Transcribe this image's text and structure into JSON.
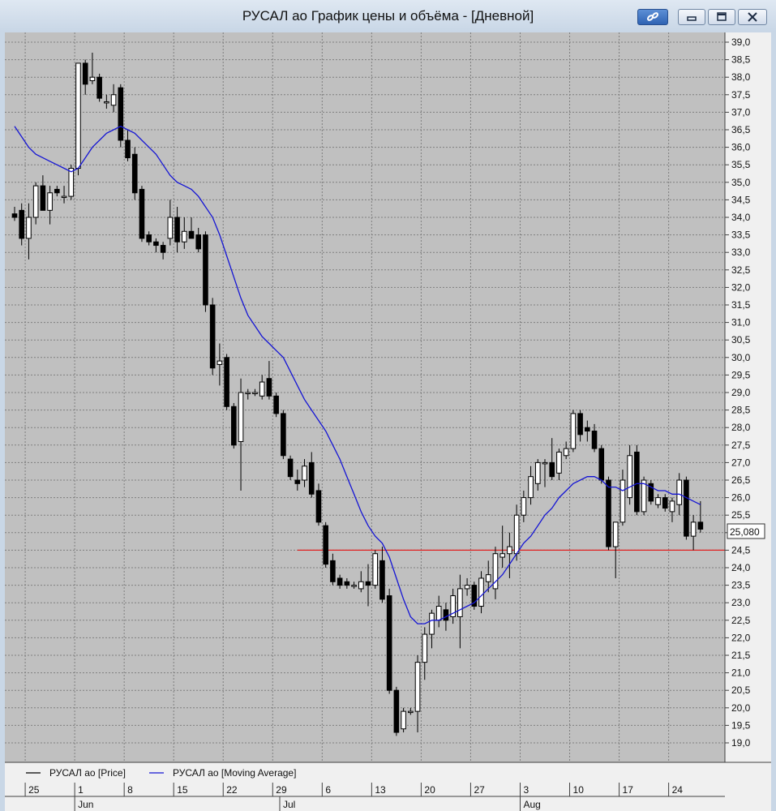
{
  "window": {
    "title": "РУСАЛ ао График цены и объёма - [Дневной]"
  },
  "colors": {
    "plot_background": "#c0c0c0",
    "grid": "#7f7f7f",
    "candle_up": "#ffffff",
    "candle_down": "#000000",
    "moving_average": "#1515d4",
    "support_line": "#e02020"
  },
  "legend": [
    {
      "label": "РУСАЛ ао [Price]",
      "color": "#000000"
    },
    {
      "label": "РУСАЛ ао [Moving Average]",
      "color": "#1515d4"
    }
  ],
  "last_price_label": "25,080",
  "chart_data": {
    "type": "candlestick",
    "ylim": [
      18.7,
      39.2
    ],
    "y_ticks": [
      "39,0",
      "38,5",
      "38,0",
      "37,5",
      "37,0",
      "36,5",
      "36,0",
      "35,5",
      "35,0",
      "34,5",
      "34,0",
      "33,5",
      "33,0",
      "32,5",
      "32,0",
      "31,5",
      "31,0",
      "30,5",
      "30,0",
      "29,5",
      "29,0",
      "28,5",
      "28,0",
      "27,5",
      "27,0",
      "26,5",
      "26,0",
      "25,5",
      "25,0",
      "24,5",
      "24,0",
      "23,5",
      "23,0",
      "22,5",
      "22,0",
      "21,5",
      "21,0",
      "20,5",
      "20,0",
      "19,5",
      "19,0"
    ],
    "x_ticks": [
      {
        "label": "25",
        "index": 2
      },
      {
        "label": "1",
        "index": 9
      },
      {
        "label": "8",
        "index": 16
      },
      {
        "label": "15",
        "index": 23
      },
      {
        "label": "22",
        "index": 30
      },
      {
        "label": "29",
        "index": 37
      },
      {
        "label": "6",
        "index": 44
      },
      {
        "label": "13",
        "index": 51
      },
      {
        "label": "20",
        "index": 58
      },
      {
        "label": "27",
        "index": 65
      },
      {
        "label": "3",
        "index": 72
      },
      {
        "label": "10",
        "index": 79
      },
      {
        "label": "17",
        "index": 86
      },
      {
        "label": "24",
        "index": 93
      }
    ],
    "months": [
      {
        "label": "Jun",
        "index": 9
      },
      {
        "label": "Jul",
        "index": 38
      },
      {
        "label": "Aug",
        "index": 72
      }
    ],
    "support_level": {
      "value": 24.5,
      "from_index": 40
    },
    "last_price": 25.08,
    "candles": [
      {
        "o": 34.1,
        "h": 34.3,
        "l": 33.9,
        "c": 34.0
      },
      {
        "o": 34.2,
        "h": 34.4,
        "l": 33.2,
        "c": 33.4
      },
      {
        "o": 33.4,
        "h": 34.4,
        "l": 32.8,
        "c": 34.0
      },
      {
        "o": 34.0,
        "h": 35.0,
        "l": 33.8,
        "c": 34.9
      },
      {
        "o": 34.9,
        "h": 35.2,
        "l": 34.2,
        "c": 34.2
      },
      {
        "o": 34.2,
        "h": 34.9,
        "l": 33.8,
        "c": 34.7
      },
      {
        "o": 34.8,
        "h": 34.9,
        "l": 34.6,
        "c": 34.7
      },
      {
        "o": 34.6,
        "h": 34.9,
        "l": 34.4,
        "c": 34.6
      },
      {
        "o": 34.6,
        "h": 35.5,
        "l": 34.5,
        "c": 35.4
      },
      {
        "o": 35.4,
        "h": 38.4,
        "l": 35.2,
        "c": 38.4
      },
      {
        "o": 38.4,
        "h": 38.5,
        "l": 37.5,
        "c": 37.8
      },
      {
        "o": 37.9,
        "h": 38.7,
        "l": 37.8,
        "c": 38.0
      },
      {
        "o": 38.0,
        "h": 38.1,
        "l": 37.3,
        "c": 37.4
      },
      {
        "o": 37.3,
        "h": 37.5,
        "l": 37.1,
        "c": 37.3
      },
      {
        "o": 37.2,
        "h": 37.8,
        "l": 37.0,
        "c": 37.5
      },
      {
        "o": 37.7,
        "h": 37.8,
        "l": 36.0,
        "c": 36.2
      },
      {
        "o": 36.2,
        "h": 36.5,
        "l": 35.6,
        "c": 35.7
      },
      {
        "o": 35.8,
        "h": 36.0,
        "l": 34.5,
        "c": 34.7
      },
      {
        "o": 34.8,
        "h": 34.9,
        "l": 33.3,
        "c": 33.4
      },
      {
        "o": 33.5,
        "h": 33.6,
        "l": 33.2,
        "c": 33.3
      },
      {
        "o": 33.3,
        "h": 33.4,
        "l": 33.0,
        "c": 33.2
      },
      {
        "o": 33.2,
        "h": 33.3,
        "l": 32.8,
        "c": 33.0
      },
      {
        "o": 33.4,
        "h": 34.5,
        "l": 33.2,
        "c": 34.0
      },
      {
        "o": 34.0,
        "h": 34.3,
        "l": 33.0,
        "c": 33.3
      },
      {
        "o": 33.3,
        "h": 34.0,
        "l": 33.1,
        "c": 33.6
      },
      {
        "o": 33.6,
        "h": 34.0,
        "l": 33.4,
        "c": 33.4
      },
      {
        "o": 33.5,
        "h": 33.7,
        "l": 33.0,
        "c": 33.1
      },
      {
        "o": 33.5,
        "h": 33.6,
        "l": 31.3,
        "c": 31.5
      },
      {
        "o": 31.5,
        "h": 31.7,
        "l": 29.5,
        "c": 29.7
      },
      {
        "o": 29.8,
        "h": 30.4,
        "l": 29.2,
        "c": 29.9
      },
      {
        "o": 30.0,
        "h": 30.1,
        "l": 28.5,
        "c": 28.6
      },
      {
        "o": 28.6,
        "h": 28.7,
        "l": 27.4,
        "c": 27.5
      },
      {
        "o": 27.6,
        "h": 29.4,
        "l": 26.2,
        "c": 29.0
      },
      {
        "o": 29.0,
        "h": 29.1,
        "l": 28.8,
        "c": 29.0
      },
      {
        "o": 29.0,
        "h": 29.1,
        "l": 28.9,
        "c": 29.0
      },
      {
        "o": 28.9,
        "h": 29.5,
        "l": 28.8,
        "c": 29.3
      },
      {
        "o": 29.4,
        "h": 29.9,
        "l": 28.8,
        "c": 28.9
      },
      {
        "o": 28.9,
        "h": 29.0,
        "l": 28.3,
        "c": 28.4
      },
      {
        "o": 28.4,
        "h": 28.5,
        "l": 27.1,
        "c": 27.2
      },
      {
        "o": 27.1,
        "h": 27.2,
        "l": 26.5,
        "c": 26.6
      },
      {
        "o": 26.5,
        "h": 26.8,
        "l": 26.2,
        "c": 26.4
      },
      {
        "o": 26.5,
        "h": 27.1,
        "l": 26.3,
        "c": 26.9
      },
      {
        "o": 27.0,
        "h": 27.3,
        "l": 26.0,
        "c": 26.1
      },
      {
        "o": 26.2,
        "h": 26.4,
        "l": 25.2,
        "c": 25.3
      },
      {
        "o": 25.2,
        "h": 25.3,
        "l": 24.0,
        "c": 24.1
      },
      {
        "o": 24.2,
        "h": 24.4,
        "l": 23.5,
        "c": 23.6
      },
      {
        "o": 23.7,
        "h": 23.8,
        "l": 23.4,
        "c": 23.5
      },
      {
        "o": 23.6,
        "h": 23.7,
        "l": 23.4,
        "c": 23.5
      },
      {
        "o": 23.5,
        "h": 23.6,
        "l": 23.4,
        "c": 23.5
      },
      {
        "o": 23.4,
        "h": 23.9,
        "l": 23.3,
        "c": 23.6
      },
      {
        "o": 23.6,
        "h": 24.1,
        "l": 22.9,
        "c": 23.5
      },
      {
        "o": 23.5,
        "h": 24.5,
        "l": 23.4,
        "c": 24.4
      },
      {
        "o": 24.2,
        "h": 24.6,
        "l": 23.0,
        "c": 23.1
      },
      {
        "o": 23.2,
        "h": 23.4,
        "l": 20.4,
        "c": 20.5
      },
      {
        "o": 20.5,
        "h": 20.6,
        "l": 19.2,
        "c": 19.3
      },
      {
        "o": 19.4,
        "h": 20.0,
        "l": 19.3,
        "c": 19.9
      },
      {
        "o": 19.9,
        "h": 20.0,
        "l": 19.8,
        "c": 19.9
      },
      {
        "o": 19.9,
        "h": 21.5,
        "l": 19.3,
        "c": 21.3
      },
      {
        "o": 21.3,
        "h": 22.3,
        "l": 20.8,
        "c": 22.1
      },
      {
        "o": 22.1,
        "h": 22.8,
        "l": 21.7,
        "c": 22.7
      },
      {
        "o": 22.5,
        "h": 23.2,
        "l": 22.3,
        "c": 22.9
      },
      {
        "o": 22.8,
        "h": 23.0,
        "l": 22.2,
        "c": 22.5
      },
      {
        "o": 22.6,
        "h": 23.4,
        "l": 22.4,
        "c": 23.2
      },
      {
        "o": 22.6,
        "h": 23.8,
        "l": 21.7,
        "c": 23.4
      },
      {
        "o": 23.4,
        "h": 23.7,
        "l": 23.2,
        "c": 23.5
      },
      {
        "o": 23.5,
        "h": 23.6,
        "l": 22.8,
        "c": 22.9
      },
      {
        "o": 22.9,
        "h": 23.9,
        "l": 22.7,
        "c": 23.7
      },
      {
        "o": 23.6,
        "h": 24.2,
        "l": 23.3,
        "c": 23.8
      },
      {
        "o": 23.4,
        "h": 24.6,
        "l": 23.1,
        "c": 24.4
      },
      {
        "o": 24.3,
        "h": 25.2,
        "l": 24.0,
        "c": 24.4
      },
      {
        "o": 24.4,
        "h": 25.0,
        "l": 23.7,
        "c": 24.6
      },
      {
        "o": 24.4,
        "h": 25.8,
        "l": 24.2,
        "c": 25.5
      },
      {
        "o": 25.5,
        "h": 26.2,
        "l": 25.3,
        "c": 26.0
      },
      {
        "o": 26.0,
        "h": 26.9,
        "l": 25.8,
        "c": 26.6
      },
      {
        "o": 26.4,
        "h": 27.1,
        "l": 26.2,
        "c": 27.0
      },
      {
        "o": 27.0,
        "h": 27.1,
        "l": 26.3,
        "c": 27.0
      },
      {
        "o": 27.0,
        "h": 27.7,
        "l": 26.5,
        "c": 26.6
      },
      {
        "o": 26.7,
        "h": 27.4,
        "l": 26.5,
        "c": 27.3
      },
      {
        "o": 27.2,
        "h": 27.6,
        "l": 27.1,
        "c": 27.4
      },
      {
        "o": 27.4,
        "h": 28.5,
        "l": 27.3,
        "c": 28.4
      },
      {
        "o": 28.4,
        "h": 28.5,
        "l": 27.6,
        "c": 27.8
      },
      {
        "o": 28.0,
        "h": 28.2,
        "l": 27.6,
        "c": 27.9
      },
      {
        "o": 27.9,
        "h": 28.1,
        "l": 27.3,
        "c": 27.4
      },
      {
        "o": 27.4,
        "h": 27.5,
        "l": 26.4,
        "c": 26.5
      },
      {
        "o": 26.5,
        "h": 26.6,
        "l": 24.5,
        "c": 24.6
      },
      {
        "o": 24.6,
        "h": 25.0,
        "l": 23.7,
        "c": 25.3
      },
      {
        "o": 25.3,
        "h": 26.8,
        "l": 25.2,
        "c": 26.5
      },
      {
        "o": 26.0,
        "h": 27.5,
        "l": 25.8,
        "c": 27.2
      },
      {
        "o": 27.3,
        "h": 27.5,
        "l": 25.5,
        "c": 25.6
      },
      {
        "o": 25.6,
        "h": 26.6,
        "l": 25.5,
        "c": 26.5
      },
      {
        "o": 26.4,
        "h": 26.5,
        "l": 25.8,
        "c": 25.9
      },
      {
        "o": 25.8,
        "h": 26.1,
        "l": 25.7,
        "c": 26.0
      },
      {
        "o": 26.0,
        "h": 26.1,
        "l": 25.6,
        "c": 25.7
      },
      {
        "o": 25.6,
        "h": 26.0,
        "l": 25.3,
        "c": 25.9
      },
      {
        "o": 25.8,
        "h": 26.7,
        "l": 25.5,
        "c": 26.5
      },
      {
        "o": 26.5,
        "h": 26.6,
        "l": 24.8,
        "c": 24.9
      },
      {
        "o": 24.9,
        "h": 25.5,
        "l": 24.5,
        "c": 25.3
      },
      {
        "o": 25.3,
        "h": 25.9,
        "l": 25.0,
        "c": 25.1
      }
    ],
    "moving_average": [
      36.6,
      36.3,
      36.0,
      35.8,
      35.7,
      35.6,
      35.5,
      35.4,
      35.3,
      35.4,
      35.7,
      36.0,
      36.2,
      36.4,
      36.5,
      36.6,
      36.5,
      36.4,
      36.2,
      36.0,
      35.8,
      35.5,
      35.2,
      35.0,
      34.9,
      34.8,
      34.6,
      34.3,
      34.0,
      33.5,
      32.9,
      32.3,
      31.7,
      31.2,
      30.9,
      30.6,
      30.4,
      30.2,
      30.0,
      29.6,
      29.2,
      28.8,
      28.5,
      28.2,
      27.9,
      27.5,
      27.1,
      26.6,
      26.1,
      25.6,
      25.2,
      24.9,
      24.7,
      24.3,
      23.7,
      23.1,
      22.6,
      22.4,
      22.4,
      22.5,
      22.5,
      22.6,
      22.7,
      22.8,
      22.9,
      23.0,
      23.2,
      23.4,
      23.6,
      23.8,
      24.1,
      24.4,
      24.7,
      24.9,
      25.2,
      25.5,
      25.7,
      26.0,
      26.2,
      26.4,
      26.5,
      26.6,
      26.6,
      26.5,
      26.3,
      26.3,
      26.2,
      26.3,
      26.4,
      26.4,
      26.3,
      26.2,
      26.2,
      26.1,
      26.1,
      26.0,
      25.9,
      25.8
    ]
  }
}
